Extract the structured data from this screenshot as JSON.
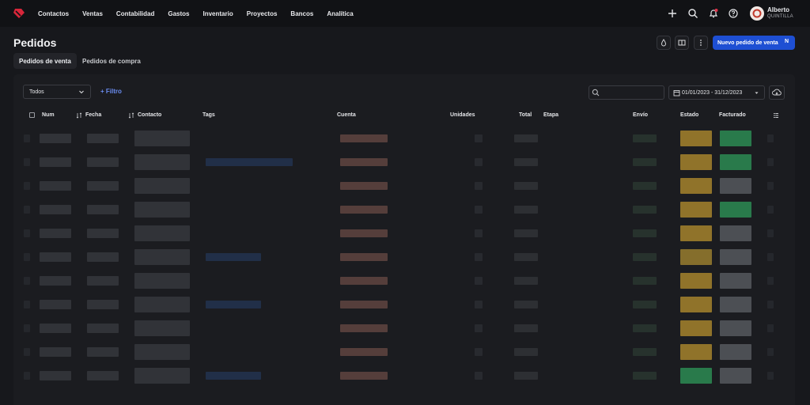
{
  "nav": {
    "links": [
      "Contactos",
      "Ventas",
      "Contabilidad",
      "Gastos",
      "Inventario",
      "Proyectos",
      "Bancos",
      "Analítica"
    ],
    "user": {
      "name": "Alberto",
      "company": "QUINTILLA"
    }
  },
  "page": {
    "title": "Pedidos",
    "new_button": "Nuevo pedido de venta",
    "new_shortcut": "N",
    "tabs": [
      "Pedidos de venta",
      "Pedidos de compra"
    ]
  },
  "toolbar": {
    "filter_select": "Todos",
    "filter_button": "+ Filtro",
    "search_value": "",
    "date_range": "01/01/2023 - 31/12/2023"
  },
  "table": {
    "columns": {
      "num": "Num",
      "fecha": "Fecha",
      "contacto": "Contacto",
      "tags": "Tags",
      "cuenta": "Cuenta",
      "unidades": "Unidades",
      "total": "Total",
      "etapa": "Etapa",
      "envio": "Envío",
      "estado": "Estado",
      "facturado": "Facturado"
    }
  },
  "colors": {
    "accent": "#1e4fd3",
    "link": "#6a8cf0",
    "status_yellow": "#b8902e",
    "status_green": "#2f9a5a",
    "status_gray": "#5d6066"
  }
}
